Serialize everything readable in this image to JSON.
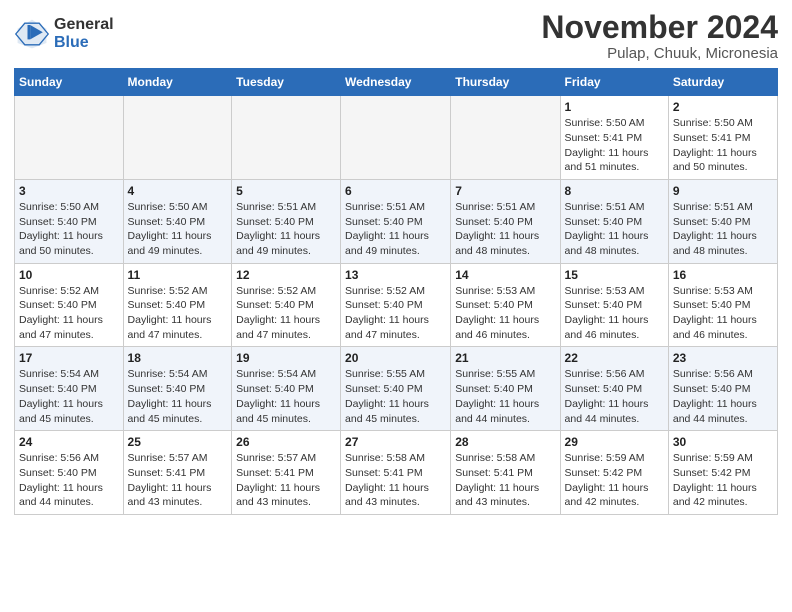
{
  "header": {
    "logo_line1": "General",
    "logo_line2": "Blue",
    "title": "November 2024",
    "subtitle": "Pulap, Chuuk, Micronesia"
  },
  "weekdays": [
    "Sunday",
    "Monday",
    "Tuesday",
    "Wednesday",
    "Thursday",
    "Friday",
    "Saturday"
  ],
  "weeks": [
    [
      {
        "day": "",
        "info": ""
      },
      {
        "day": "",
        "info": ""
      },
      {
        "day": "",
        "info": ""
      },
      {
        "day": "",
        "info": ""
      },
      {
        "day": "",
        "info": ""
      },
      {
        "day": "1",
        "info": "Sunrise: 5:50 AM\nSunset: 5:41 PM\nDaylight: 11 hours\nand 51 minutes."
      },
      {
        "day": "2",
        "info": "Sunrise: 5:50 AM\nSunset: 5:41 PM\nDaylight: 11 hours\nand 50 minutes."
      }
    ],
    [
      {
        "day": "3",
        "info": "Sunrise: 5:50 AM\nSunset: 5:40 PM\nDaylight: 11 hours\nand 50 minutes."
      },
      {
        "day": "4",
        "info": "Sunrise: 5:50 AM\nSunset: 5:40 PM\nDaylight: 11 hours\nand 49 minutes."
      },
      {
        "day": "5",
        "info": "Sunrise: 5:51 AM\nSunset: 5:40 PM\nDaylight: 11 hours\nand 49 minutes."
      },
      {
        "day": "6",
        "info": "Sunrise: 5:51 AM\nSunset: 5:40 PM\nDaylight: 11 hours\nand 49 minutes."
      },
      {
        "day": "7",
        "info": "Sunrise: 5:51 AM\nSunset: 5:40 PM\nDaylight: 11 hours\nand 48 minutes."
      },
      {
        "day": "8",
        "info": "Sunrise: 5:51 AM\nSunset: 5:40 PM\nDaylight: 11 hours\nand 48 minutes."
      },
      {
        "day": "9",
        "info": "Sunrise: 5:51 AM\nSunset: 5:40 PM\nDaylight: 11 hours\nand 48 minutes."
      }
    ],
    [
      {
        "day": "10",
        "info": "Sunrise: 5:52 AM\nSunset: 5:40 PM\nDaylight: 11 hours\nand 47 minutes."
      },
      {
        "day": "11",
        "info": "Sunrise: 5:52 AM\nSunset: 5:40 PM\nDaylight: 11 hours\nand 47 minutes."
      },
      {
        "day": "12",
        "info": "Sunrise: 5:52 AM\nSunset: 5:40 PM\nDaylight: 11 hours\nand 47 minutes."
      },
      {
        "day": "13",
        "info": "Sunrise: 5:52 AM\nSunset: 5:40 PM\nDaylight: 11 hours\nand 47 minutes."
      },
      {
        "day": "14",
        "info": "Sunrise: 5:53 AM\nSunset: 5:40 PM\nDaylight: 11 hours\nand 46 minutes."
      },
      {
        "day": "15",
        "info": "Sunrise: 5:53 AM\nSunset: 5:40 PM\nDaylight: 11 hours\nand 46 minutes."
      },
      {
        "day": "16",
        "info": "Sunrise: 5:53 AM\nSunset: 5:40 PM\nDaylight: 11 hours\nand 46 minutes."
      }
    ],
    [
      {
        "day": "17",
        "info": "Sunrise: 5:54 AM\nSunset: 5:40 PM\nDaylight: 11 hours\nand 45 minutes."
      },
      {
        "day": "18",
        "info": "Sunrise: 5:54 AM\nSunset: 5:40 PM\nDaylight: 11 hours\nand 45 minutes."
      },
      {
        "day": "19",
        "info": "Sunrise: 5:54 AM\nSunset: 5:40 PM\nDaylight: 11 hours\nand 45 minutes."
      },
      {
        "day": "20",
        "info": "Sunrise: 5:55 AM\nSunset: 5:40 PM\nDaylight: 11 hours\nand 45 minutes."
      },
      {
        "day": "21",
        "info": "Sunrise: 5:55 AM\nSunset: 5:40 PM\nDaylight: 11 hours\nand 44 minutes."
      },
      {
        "day": "22",
        "info": "Sunrise: 5:56 AM\nSunset: 5:40 PM\nDaylight: 11 hours\nand 44 minutes."
      },
      {
        "day": "23",
        "info": "Sunrise: 5:56 AM\nSunset: 5:40 PM\nDaylight: 11 hours\nand 44 minutes."
      }
    ],
    [
      {
        "day": "24",
        "info": "Sunrise: 5:56 AM\nSunset: 5:40 PM\nDaylight: 11 hours\nand 44 minutes."
      },
      {
        "day": "25",
        "info": "Sunrise: 5:57 AM\nSunset: 5:41 PM\nDaylight: 11 hours\nand 43 minutes."
      },
      {
        "day": "26",
        "info": "Sunrise: 5:57 AM\nSunset: 5:41 PM\nDaylight: 11 hours\nand 43 minutes."
      },
      {
        "day": "27",
        "info": "Sunrise: 5:58 AM\nSunset: 5:41 PM\nDaylight: 11 hours\nand 43 minutes."
      },
      {
        "day": "28",
        "info": "Sunrise: 5:58 AM\nSunset: 5:41 PM\nDaylight: 11 hours\nand 43 minutes."
      },
      {
        "day": "29",
        "info": "Sunrise: 5:59 AM\nSunset: 5:42 PM\nDaylight: 11 hours\nand 42 minutes."
      },
      {
        "day": "30",
        "info": "Sunrise: 5:59 AM\nSunset: 5:42 PM\nDaylight: 11 hours\nand 42 minutes."
      }
    ]
  ]
}
